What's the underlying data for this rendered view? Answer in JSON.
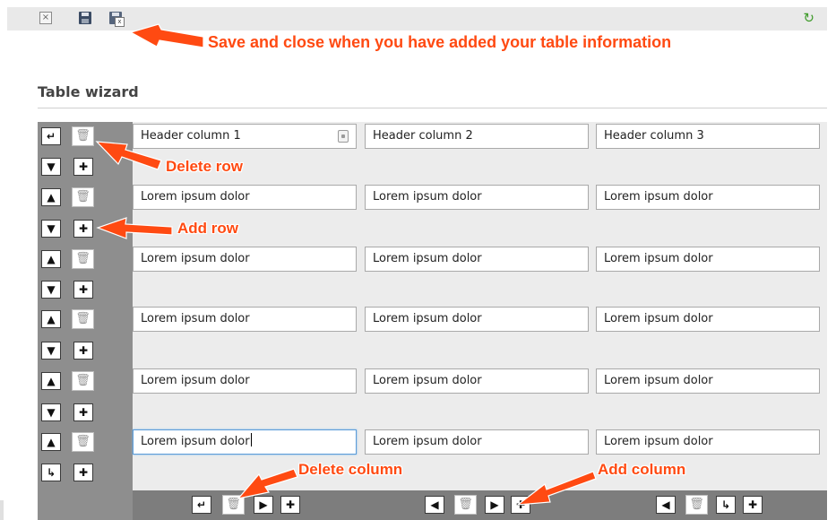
{
  "toolbar": {
    "close_label": "×",
    "refresh_label": "↻"
  },
  "annotations": {
    "save_close": "Save and close when you have added your table information",
    "delete_row": "Delete row",
    "add_row": "Add row",
    "delete_column": "Delete column",
    "add_column": "Add column"
  },
  "page_title": "Table wizard",
  "table": {
    "header": [
      "Header column 1",
      "Header column 2",
      "Header column 3"
    ],
    "rows": [
      [
        "Lorem ipsum dolor",
        "Lorem ipsum dolor",
        "Lorem ipsum dolor"
      ],
      [
        "Lorem ipsum dolor",
        "Lorem ipsum dolor",
        "Lorem ipsum dolor"
      ],
      [
        "Lorem ipsum dolor",
        "Lorem ipsum dolor",
        "Lorem ipsum dolor"
      ],
      [
        "Lorem ipsum dolor",
        "Lorem ipsum dolor",
        "Lorem ipsum dolor"
      ],
      [
        "Lorem ipsum dolor",
        "Lorem ipsum dolor",
        "Lorem ipsum dolor"
      ]
    ]
  },
  "glyphs": {
    "move_top": "↵",
    "move_bottom": "↳",
    "up": "▲",
    "down": "▼",
    "add": "✚",
    "trash": "🗑",
    "left": "◀",
    "right": "▶",
    "col_move_first": "↵",
    "col_move_last": "↳"
  },
  "colors": {
    "annotation": "#ff4a12",
    "refresh_icon": "#3f9b2b"
  }
}
